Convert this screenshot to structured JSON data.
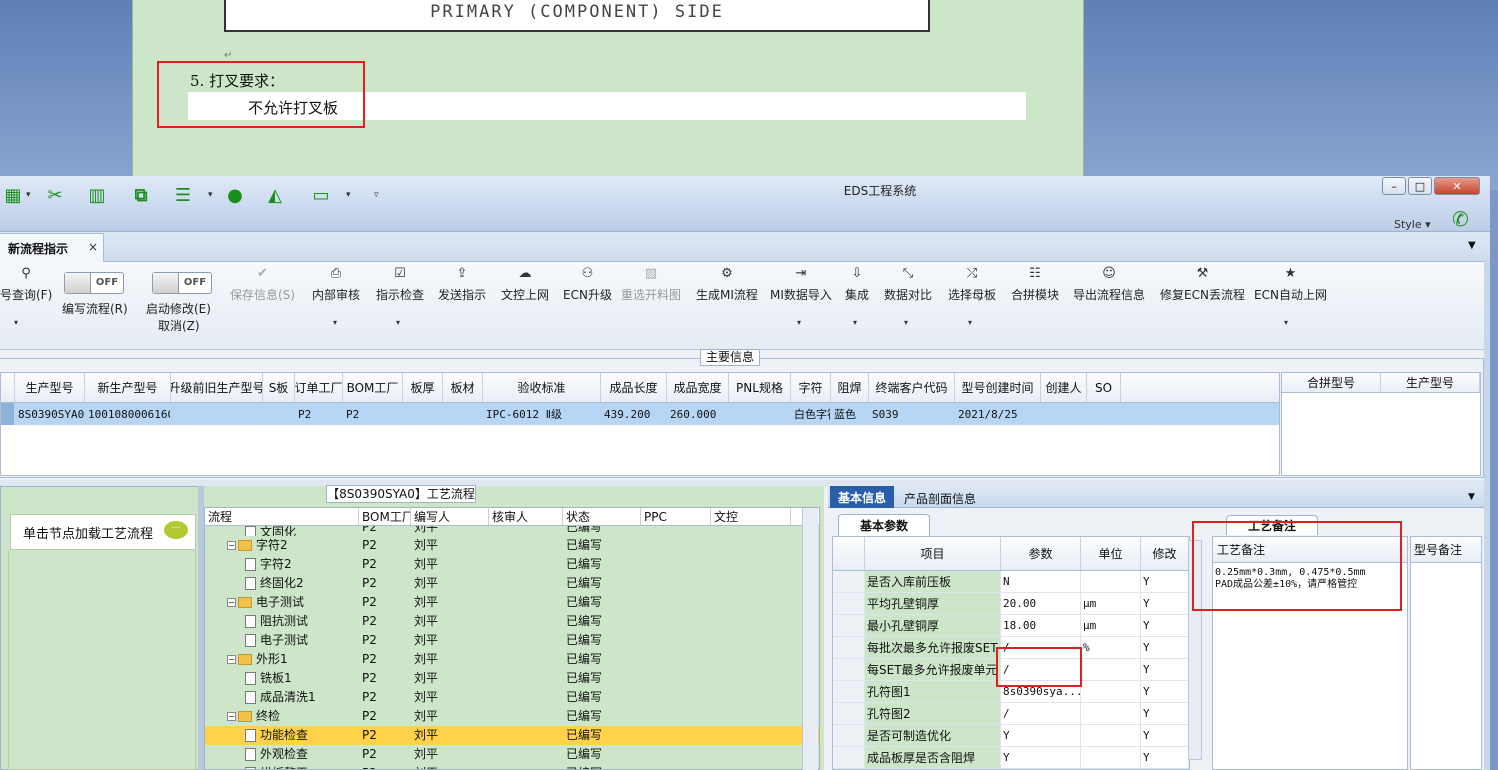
{
  "document": {
    "box_text": "PRIMARY (COMPONENT) SIDE",
    "line5_heading": "5. 打叉要求：",
    "line5_body": "不允许打叉板"
  },
  "window": {
    "title": "EDS工程系统",
    "style_label": "Style",
    "min_label": "–",
    "max_label": "□",
    "close_label": "✕"
  },
  "quick_access_icons": [
    "table-icon",
    "scissors-icon",
    "film-icon",
    "copy-icon",
    "list-icon",
    "user-icon",
    "area-chart-icon",
    "monitor-icon"
  ],
  "tabs": {
    "active": "新流程指示",
    "close": "×"
  },
  "ribbon": {
    "query": "号查询(F)",
    "toggle_off": "OFF",
    "edit_flow": "编写流程(R)",
    "start_modify": "启动修改(E)",
    "cancel": "取消(Z)",
    "save_info": "保存信息(S)",
    "internal_audit": "内部审核",
    "instruction_check": "指示检查",
    "send_instruction": "发送指示",
    "doc_upload": "文控上网",
    "ecn_upgrade": "ECN升级",
    "reselect_drawing": "重选开料图",
    "generate_mi": "生成MI流程",
    "mi_import": "MI数据导入",
    "integrate": "集成",
    "data_compare": "数据对比",
    "select_master": "选择母板",
    "merge_module": "合拼模块",
    "export_flow": "导出流程信息",
    "fix_ecn": "修复ECN丢流程",
    "ecn_auto": "ECN自动上网"
  },
  "main_info": {
    "label": "主要信息",
    "columns": [
      "生产型号",
      "新生产型号",
      "升级前旧生产型号",
      "S板",
      "订单工厂",
      "BOM工厂",
      "板厚",
      "板材",
      "验收标准",
      "成品长度",
      "成品宽度",
      "PNL规格",
      "字符",
      "阻焊",
      "终端客户代码",
      "型号创建时间",
      "创建人",
      "SO"
    ],
    "row": [
      "8S0390SYA0",
      "10010800061608",
      "",
      "",
      "P2",
      "P2",
      "",
      "",
      "IPC-6012 Ⅱ级",
      "439.200",
      "260.000",
      "",
      "白色字符",
      "蓝色",
      "S039",
      "2021/8/25",
      "",
      ""
    ],
    "merge_columns": [
      "合拼型号",
      "生产型号"
    ]
  },
  "node_panel": {
    "hint": "单击节点加载工艺流程",
    "bubble": "···"
  },
  "process": {
    "label": "【8S0390SYA0】工艺流程",
    "columns": [
      "流程",
      "BOM工厂",
      "编写人",
      "核审人",
      "状态",
      "PPC",
      "文控"
    ],
    "rows": [
      {
        "indent": 2,
        "type": "doc",
        "name": "文固化",
        "bom": "P2",
        "writer": "刘平",
        "status": "已编写",
        "selected": false,
        "partial": true
      },
      {
        "indent": 1,
        "type": "folder",
        "name": "字符2",
        "bom": "P2",
        "writer": "刘平",
        "status": "已编写",
        "selected": false
      },
      {
        "indent": 2,
        "type": "doc",
        "name": "字符2",
        "bom": "P2",
        "writer": "刘平",
        "status": "已编写",
        "selected": false
      },
      {
        "indent": 2,
        "type": "doc",
        "name": "终固化2",
        "bom": "P2",
        "writer": "刘平",
        "status": "已编写",
        "selected": false
      },
      {
        "indent": 1,
        "type": "folder",
        "name": "电子测试",
        "bom": "P2",
        "writer": "刘平",
        "status": "已编写",
        "selected": false
      },
      {
        "indent": 2,
        "type": "doc",
        "name": "阻抗测试",
        "bom": "P2",
        "writer": "刘平",
        "status": "已编写",
        "selected": false
      },
      {
        "indent": 2,
        "type": "doc",
        "name": "电子测试",
        "bom": "P2",
        "writer": "刘平",
        "status": "已编写",
        "selected": false
      },
      {
        "indent": 1,
        "type": "folder",
        "name": "外形1",
        "bom": "P2",
        "writer": "刘平",
        "status": "已编写",
        "selected": false
      },
      {
        "indent": 2,
        "type": "doc",
        "name": "铣板1",
        "bom": "P2",
        "writer": "刘平",
        "status": "已编写",
        "selected": false
      },
      {
        "indent": 2,
        "type": "doc",
        "name": "成品清洗1",
        "bom": "P2",
        "writer": "刘平",
        "status": "已编写",
        "selected": false
      },
      {
        "indent": 1,
        "type": "folder",
        "name": "终检",
        "bom": "P2",
        "writer": "刘平",
        "status": "已编写",
        "selected": false
      },
      {
        "indent": 2,
        "type": "doc",
        "name": "功能检查",
        "bom": "P2",
        "writer": "刘平",
        "status": "已编写",
        "selected": true
      },
      {
        "indent": 2,
        "type": "doc",
        "name": "外观检查",
        "bom": "P2",
        "writer": "刘平",
        "status": "已编写",
        "selected": false
      },
      {
        "indent": 2,
        "type": "doc",
        "name": "烘板整平",
        "bom": "P2",
        "writer": "刘平",
        "status": "已编写",
        "selected": false
      }
    ]
  },
  "basic_info": {
    "tab_active": "基本信息",
    "tab_other": "产品剖面信息",
    "param_tab": "基本参数",
    "columns": [
      "项目",
      "参数",
      "单位",
      "修改"
    ],
    "rows": [
      {
        "item": "是否入库前压板",
        "value": "N",
        "unit": "",
        "modify": "Y"
      },
      {
        "item": "平均孔壁铜厚",
        "value": "20.00",
        "unit": "μm",
        "modify": "Y"
      },
      {
        "item": "最小孔壁铜厚",
        "value": "18.00",
        "unit": "μm",
        "modify": "Y"
      },
      {
        "item": "每批次最多允许报废SET",
        "value": "/",
        "unit": "%",
        "modify": "Y"
      },
      {
        "item": "每SET最多允许报废单元",
        "value": "/",
        "unit": "",
        "modify": "Y"
      },
      {
        "item": "孔符图1",
        "value": "8s0390sya...",
        "unit": "",
        "modify": "Y"
      },
      {
        "item": "孔符图2",
        "value": "/",
        "unit": "",
        "modify": "Y"
      },
      {
        "item": "是否可制造优化",
        "value": "Y",
        "unit": "",
        "modify": "Y"
      },
      {
        "item": "成品板厚是否含阻焊",
        "value": "Y",
        "unit": "",
        "modify": "Y"
      }
    ]
  },
  "remark": {
    "tab": "工艺备注",
    "header": "工艺备注",
    "text": "0.25mm*0.3mm, 0.475*0.5mm\nPAD成品公差±10%，请严格管控",
    "type_header": "型号备注"
  },
  "colors": {
    "accent_green": "#1a8f1a",
    "selection_blue": "#b7d6f5",
    "tree_selection": "#ffd24a",
    "highlight_red": "#e02020",
    "panel_green": "#cde6c9"
  }
}
